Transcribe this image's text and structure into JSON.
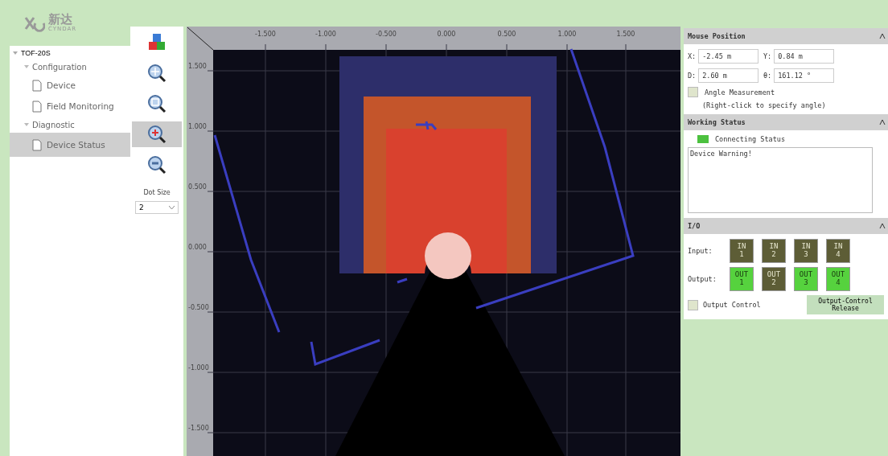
{
  "logo": {
    "name": "新达",
    "subtitle": "CYNDAR"
  },
  "tree": {
    "label": "TOF-20S",
    "expanded": true,
    "children": [
      {
        "label": "Configuration",
        "expanded": true,
        "children": [
          {
            "label": "Device",
            "selected": false
          },
          {
            "label": "Field Monitoring",
            "selected": false
          }
        ]
      },
      {
        "label": "Diagnostic",
        "expanded": true,
        "children": [
          {
            "label": "Device Status",
            "selected": true
          }
        ]
      }
    ]
  },
  "toolbar": {
    "tools": [
      {
        "kind": "view3d",
        "selected": false
      },
      {
        "kind": "zoom-fit",
        "selected": false
      },
      {
        "kind": "zoom-area",
        "selected": false
      },
      {
        "kind": "zoom-in",
        "selected": true
      },
      {
        "kind": "zoom-out",
        "selected": false
      }
    ],
    "dot_size_label": "Dot Size",
    "dot_size": "2"
  },
  "plot": {
    "x_ticks": [
      "-1.500",
      "-1.000",
      "-0.500",
      "0.000",
      "0.500",
      "1.000",
      "1.500"
    ],
    "y_ticks": [
      "1.500",
      "1.000",
      "0.500",
      "0.000",
      "-0.500",
      "-1.000",
      "-1.500"
    ]
  },
  "mouse_position": {
    "title": "Mouse Position",
    "fields": [
      {
        "label": "X:",
        "value": "-2.45 m"
      },
      {
        "label": "Y:",
        "value": "0.84 m"
      },
      {
        "label": "D:",
        "value": "2.60 m"
      },
      {
        "label": "θ:",
        "value": "161.12 °"
      }
    ],
    "angle_measurement": {
      "label": "Angle Measurement",
      "checked": false,
      "hint": "(Right-click to specify angle)"
    }
  },
  "working_status": {
    "title": "Working Status",
    "connecting": {
      "label": "Connecting Status",
      "on": true
    },
    "log": "Device Warning!"
  },
  "io": {
    "title": "I/O",
    "input_label": "Input:",
    "inputs": [
      {
        "label": "IN\n1",
        "on": false
      },
      {
        "label": "IN\n2",
        "on": false
      },
      {
        "label": "IN\n3",
        "on": false
      },
      {
        "label": "IN\n4",
        "on": false
      }
    ],
    "output_label": "Output:",
    "outputs": [
      {
        "label": "OUT\n1",
        "on": true
      },
      {
        "label": "OUT\n2",
        "on": false
      },
      {
        "label": "OUT\n3",
        "on": true
      },
      {
        "label": "OUT\n4",
        "on": true
      }
    ],
    "output_control": {
      "label": "Output Control",
      "checked": false
    },
    "release_button": "Output-Control Release"
  }
}
